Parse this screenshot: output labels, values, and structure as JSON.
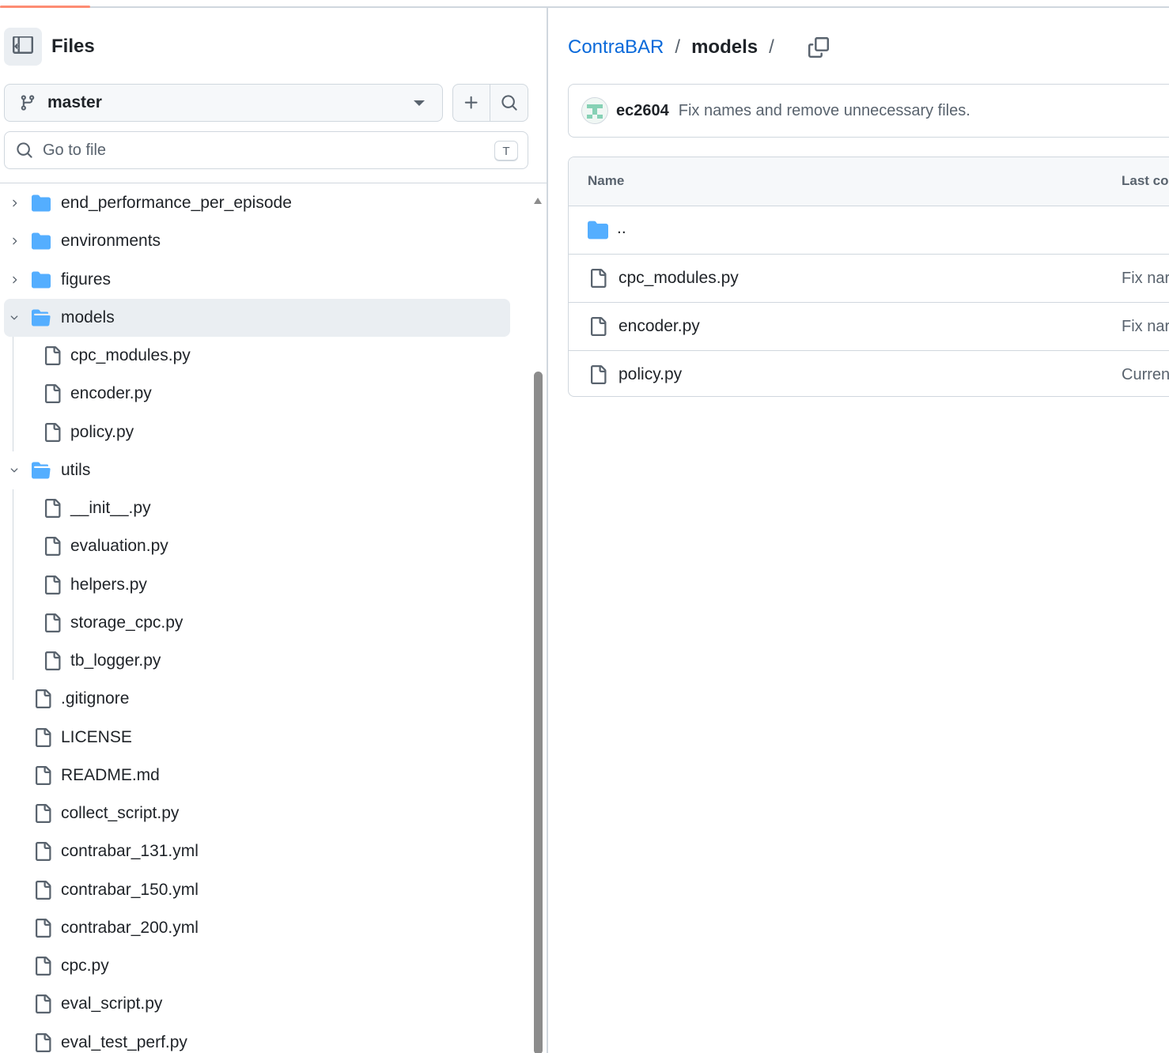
{
  "sidebar": {
    "title": "Files",
    "branch": "master",
    "search_placeholder": "Go to file",
    "search_shortcut": "T",
    "tree": [
      {
        "name": "end_performance_per_episode",
        "type": "folder",
        "expanded": false,
        "depth": 0
      },
      {
        "name": "environments",
        "type": "folder",
        "expanded": false,
        "depth": 0
      },
      {
        "name": "figures",
        "type": "folder",
        "expanded": false,
        "depth": 0
      },
      {
        "name": "models",
        "type": "folder",
        "expanded": true,
        "depth": 0,
        "selected": true
      },
      {
        "name": "cpc_modules.py",
        "type": "file",
        "depth": 1
      },
      {
        "name": "encoder.py",
        "type": "file",
        "depth": 1
      },
      {
        "name": "policy.py",
        "type": "file",
        "depth": 1
      },
      {
        "name": "utils",
        "type": "folder",
        "expanded": true,
        "depth": 0
      },
      {
        "name": "__init__.py",
        "type": "file",
        "depth": 1
      },
      {
        "name": "evaluation.py",
        "type": "file",
        "depth": 1
      },
      {
        "name": "helpers.py",
        "type": "file",
        "depth": 1
      },
      {
        "name": "storage_cpc.py",
        "type": "file",
        "depth": 1
      },
      {
        "name": "tb_logger.py",
        "type": "file",
        "depth": 1
      },
      {
        "name": ".gitignore",
        "type": "file",
        "depth": 0
      },
      {
        "name": "LICENSE",
        "type": "file",
        "depth": 0
      },
      {
        "name": "README.md",
        "type": "file",
        "depth": 0
      },
      {
        "name": "collect_script.py",
        "type": "file",
        "depth": 0
      },
      {
        "name": "contrabar_131.yml",
        "type": "file",
        "depth": 0
      },
      {
        "name": "contrabar_150.yml",
        "type": "file",
        "depth": 0
      },
      {
        "name": "contrabar_200.yml",
        "type": "file",
        "depth": 0
      },
      {
        "name": "cpc.py",
        "type": "file",
        "depth": 0
      },
      {
        "name": "eval_script.py",
        "type": "file",
        "depth": 0
      },
      {
        "name": "eval_test_perf.py",
        "type": "file",
        "depth": 0
      }
    ]
  },
  "breadcrumb": {
    "repo": "ContraBAR",
    "separator": "/",
    "current": "models"
  },
  "commit": {
    "author": "ec2604",
    "message": "Fix names and remove unnecessary files."
  },
  "table": {
    "headers": {
      "name": "Name",
      "last_commit": "Last cor"
    },
    "parent_dir": "..",
    "rows": [
      {
        "name": "cpc_modules.py",
        "commit": "Fix nar"
      },
      {
        "name": "encoder.py",
        "commit": "Fix nar"
      },
      {
        "name": "policy.py",
        "commit": "Curren"
      }
    ]
  },
  "colors": {
    "folder": "#54aeff",
    "link": "#0969da",
    "progress": "#fd8c73"
  }
}
